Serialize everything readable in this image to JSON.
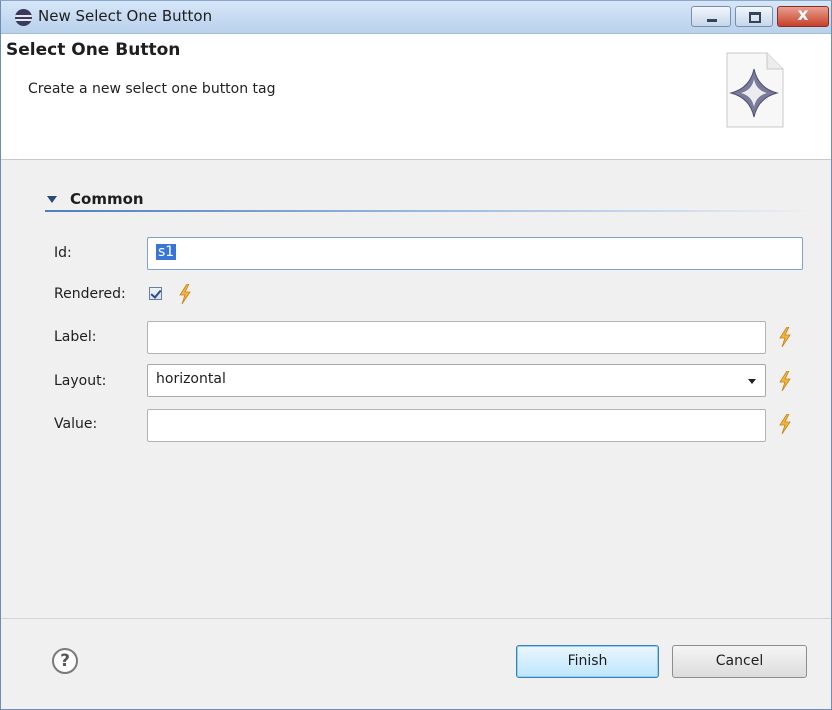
{
  "window": {
    "title": "New Select One Button",
    "title_icon": "eclipse-icon",
    "controls": {
      "minimize": "minimize-icon",
      "maximize": "maximize-icon",
      "close_label": "x"
    }
  },
  "header": {
    "title": "Select One Button",
    "description": "Create a new select one button tag",
    "icon": "wizard-star-icon"
  },
  "section": {
    "title": "Common",
    "expanded": true
  },
  "fields": {
    "id": {
      "label": "Id:",
      "value": "s1"
    },
    "rendered": {
      "label": "Rendered:",
      "checked": true
    },
    "label": {
      "label": "Label:",
      "value": ""
    },
    "layout": {
      "label": "Layout:",
      "value": "horizontal"
    },
    "value": {
      "label": "Value:",
      "value": ""
    }
  },
  "buttons": {
    "finish": "Finish",
    "cancel": "Cancel",
    "help_glyph": "?"
  },
  "colors": {
    "accent": "#3875d7",
    "bolt": "#e8a418",
    "section_line": "#4f7fbf"
  }
}
